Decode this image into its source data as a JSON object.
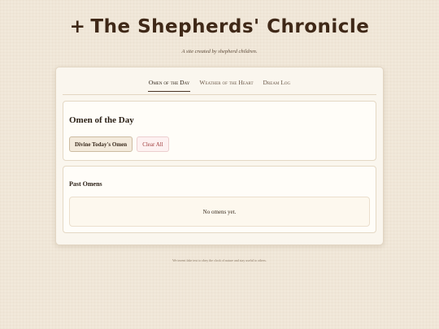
{
  "header": {
    "cross_glyph": "+",
    "title": "The Shepherds' Chronicle",
    "subtitle": "A site created by shepherd children."
  },
  "tabs": [
    {
      "label": "Omen of the Day",
      "active": true
    },
    {
      "label": "Weather of the Heart",
      "active": false
    },
    {
      "label": "Dream Log",
      "active": false
    }
  ],
  "omen_panel": {
    "title": "Omen of the Day",
    "divine_button": "Divine Today's Omen",
    "clear_button": "Clear All"
  },
  "past_panel": {
    "title": "Past Omens",
    "empty_text": "No omens yet."
  },
  "footer": {
    "text": "We invent fake text to obey the clock of nature and stay useful to others."
  },
  "colors": {
    "background": "#f1e8da",
    "title": "#3f2817",
    "clear_button_text": "#a13c3c"
  }
}
